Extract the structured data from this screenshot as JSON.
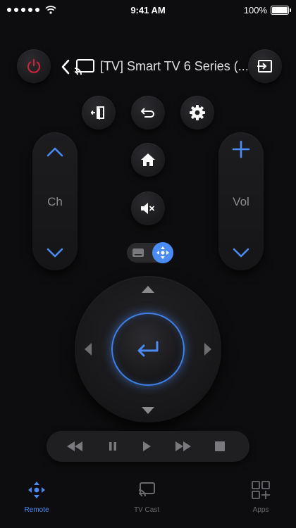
{
  "status_bar": {
    "time": "9:41 AM",
    "battery": "100%"
  },
  "header": {
    "device_title": "[TV] Smart TV 6 Series (..."
  },
  "controls": {
    "channel_label": "Ch",
    "volume_label": "Vol"
  },
  "tabs": [
    {
      "label": "Remote",
      "active": true
    },
    {
      "label": "TV Cast",
      "active": false
    },
    {
      "label": "Apps",
      "active": false
    }
  ],
  "colors": {
    "accent": "#4a8bf5",
    "power": "#c8243c",
    "background": "#0d0d0f"
  },
  "icons": {
    "power": "power-icon",
    "back": "chevron-left-icon",
    "cast": "cast-icon",
    "input": "input-source-icon",
    "exit": "exit-icon",
    "return": "return-icon",
    "settings": "gear-icon",
    "home": "home-icon",
    "mute": "mute-icon",
    "enter": "enter-icon"
  }
}
